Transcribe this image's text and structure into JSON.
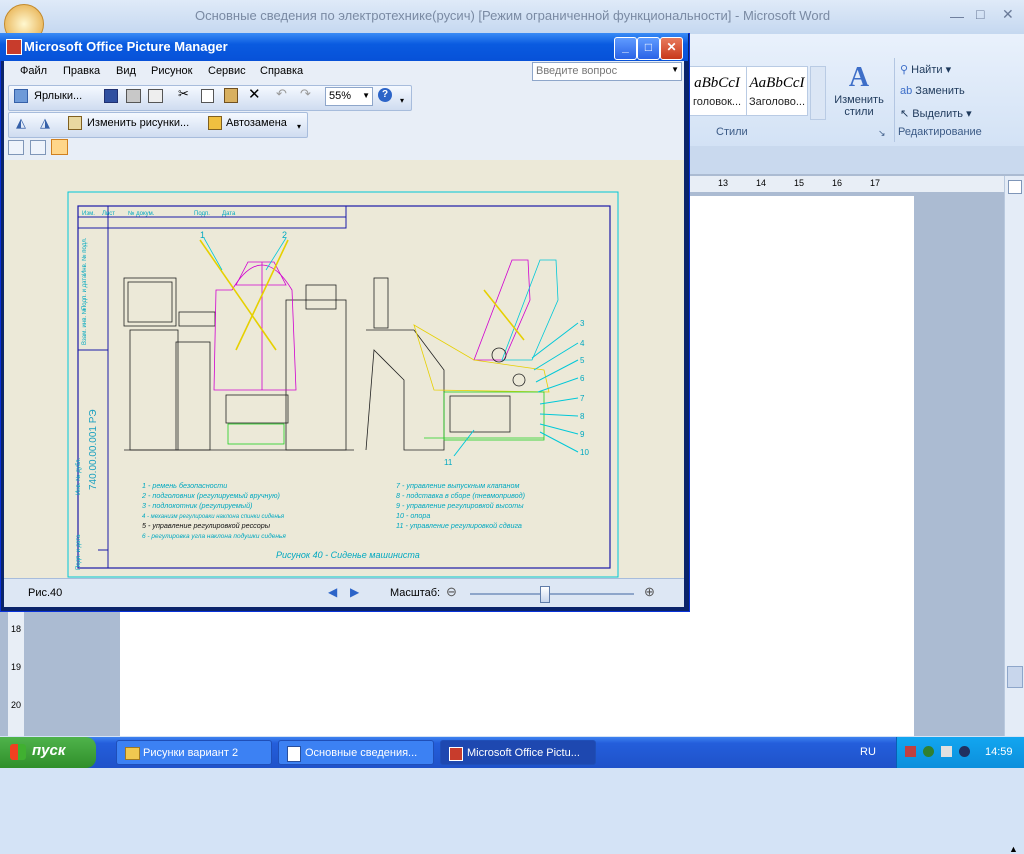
{
  "word": {
    "title": "Основные сведения по электротехнике(русич) [Режим ограниченной функциональности] - Microsoft Word",
    "styles": [
      {
        "sample": "aBbCcI",
        "name": "головок..."
      },
      {
        "sample": "AaBbCcI",
        "name": "Заголово..."
      }
    ],
    "change_styles": "Изменить стили",
    "styles_group": "Стили",
    "find": "Найти",
    "replace": "Заменить",
    "select": "Выделить",
    "editing_group": "Редактирование",
    "ruler_marks": [
      "13",
      "14",
      "15",
      "16",
      "17"
    ],
    "left_ruler_marks": [
      "18",
      "19",
      "20"
    ]
  },
  "picture_manager": {
    "title": "Microsoft Office Picture Manager",
    "menu": [
      "Файл",
      "Правка",
      "Вид",
      "Рисунок",
      "Сервис",
      "Справка"
    ],
    "help_placeholder": "Введите вопрос",
    "shortcuts_label": "Ярлыки...",
    "zoom_value": "55%",
    "edit_pictures_label": "Изменить рисунки...",
    "autofix_label": "Автозамена",
    "status_file": "Рис.40",
    "zoom_label": "Масштаб:",
    "zoom_fraction": 0.45
  },
  "drawing": {
    "header_cells": [
      "Изм.",
      "Лист",
      "№ докум.",
      "Подп.",
      "Дата"
    ],
    "doc_code": "740.00.00.001 РЭ",
    "callouts_top": [
      "1",
      "2"
    ],
    "callouts_right": [
      "3",
      "4",
      "5",
      "6",
      "7",
      "8",
      "9",
      "10"
    ],
    "callout_bottom": "11",
    "legend_left": [
      "1 - ремень безопасности",
      "2 - подголовник (регулируемый вручную)",
      "3 - подлокотник (регулируемый)",
      "4 - механизм регулировки наклона спинки сиденья",
      "5 - управление регулировкой рессоры",
      "6 - регулировка угла наклона подушки сиденья"
    ],
    "legend_right": [
      "7 - управление выпускным клапаном",
      "8 - подставка в сборе (пневмопривод)",
      "9 - управление регулировкой высоты",
      "10 - опора",
      "11 - управление регулировкой сдвига"
    ],
    "caption": "Рисунок 40 - Сиденье машиниста",
    "side_labels": [
      "Инв. № подл.",
      "Подп. и дата",
      "Взам. инв. №",
      "Инв. № дубл.",
      "Подп. и дата"
    ]
  },
  "taskbar": {
    "start": "пуск",
    "tasks": [
      "Рисунки вариант 2",
      "Основные сведения...",
      "Microsoft Office Pictu..."
    ],
    "lang": "RU",
    "clock": "14:59"
  },
  "colors": {
    "drawing_frame": "#1a1aa8",
    "cyan_lines": "#00c8d8",
    "magenta_lines": "#d000d0",
    "yellow_lines": "#e6d000",
    "green_lines": "#20d020"
  }
}
